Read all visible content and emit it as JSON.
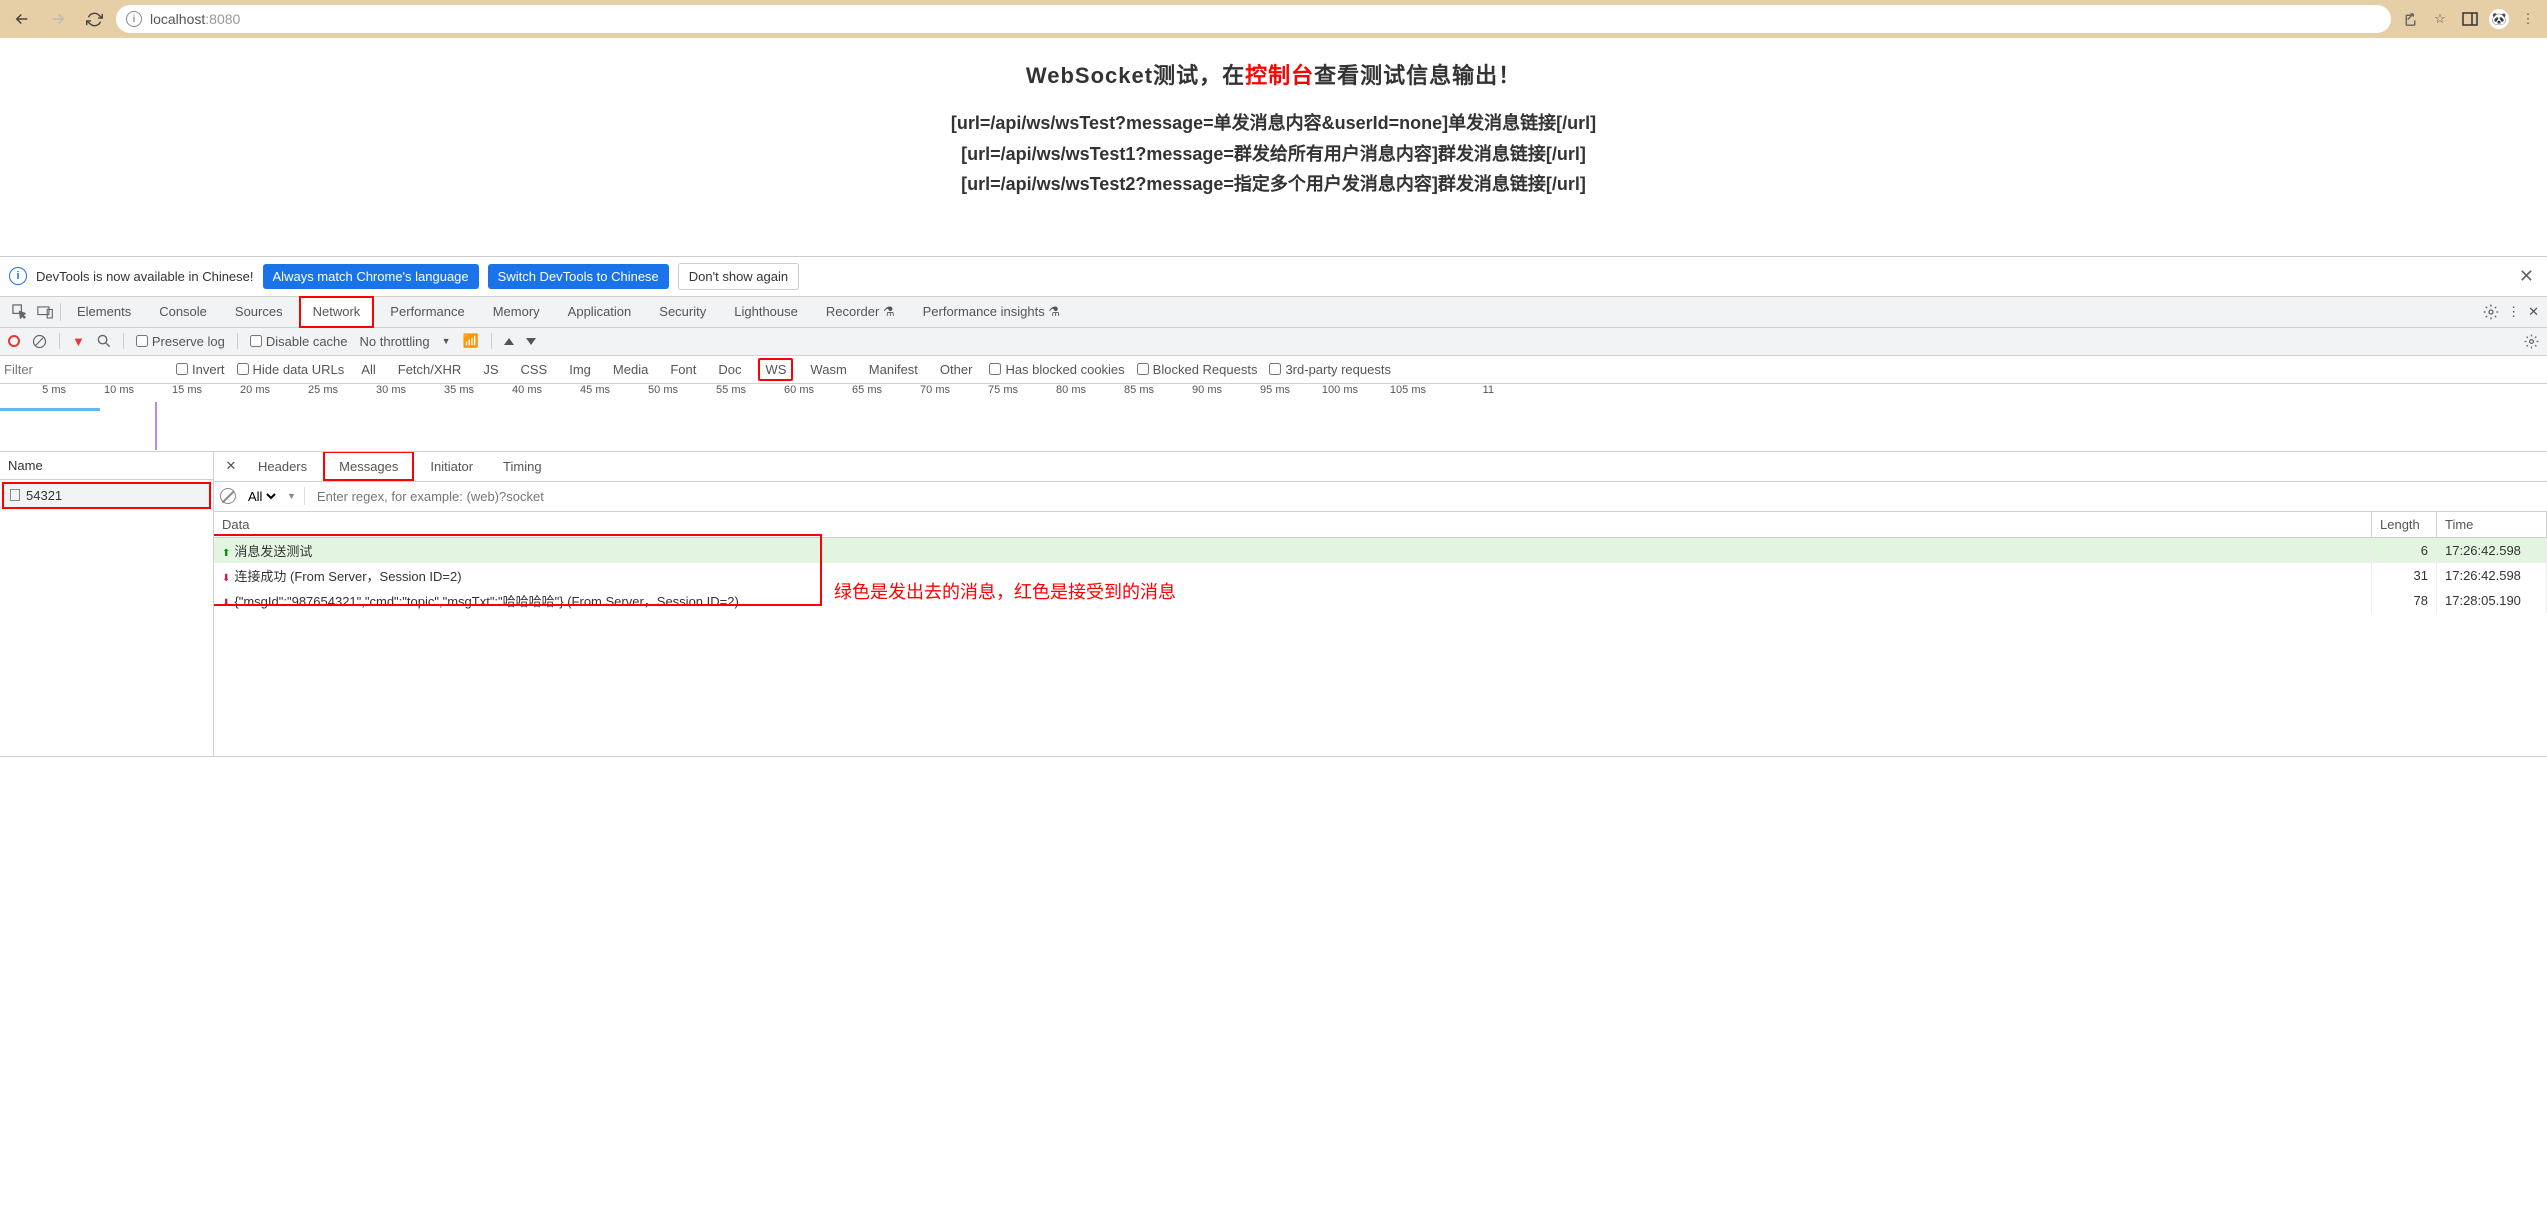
{
  "browser": {
    "url_host": "localhost",
    "url_port": ":8080"
  },
  "page": {
    "title_pre": "WebSocket测试，在",
    "title_red": "控制台",
    "title_post": "查看测试信息输出！",
    "line1": "[url=/api/ws/wsTest?message=单发消息内容&userId=none]单发消息链接[/url]",
    "line2": "[url=/api/ws/wsTest1?message=群发给所有用户消息内容]群发消息链接[/url]",
    "line3": "[url=/api/ws/wsTest2?message=指定多个用户发消息内容]群发消息链接[/url]"
  },
  "lang_bar": {
    "msg": "DevTools is now available in Chinese!",
    "btn1": "Always match Chrome's language",
    "btn2": "Switch DevTools to Chinese",
    "btn3": "Don't show again"
  },
  "devtools_tabs": [
    "Elements",
    "Console",
    "Sources",
    "Network",
    "Performance",
    "Memory",
    "Application",
    "Security",
    "Lighthouse",
    "Recorder ⚗",
    "Performance insights ⚗"
  ],
  "nw1": {
    "preserve": "Preserve log",
    "disable": "Disable cache",
    "throttle": "No throttling"
  },
  "nw2": {
    "filter_ph": "Filter",
    "invert": "Invert",
    "hide": "Hide data URLs",
    "types": [
      "All",
      "Fetch/XHR",
      "JS",
      "CSS",
      "Img",
      "Media",
      "Font",
      "Doc",
      "WS",
      "Wasm",
      "Manifest",
      "Other"
    ],
    "blocked": "Has blocked cookies",
    "blockedr": "Blocked Requests",
    "third": "3rd-party requests"
  },
  "timeline_ticks": [
    "5 ms",
    "10 ms",
    "15 ms",
    "20 ms",
    "25 ms",
    "30 ms",
    "35 ms",
    "40 ms",
    "45 ms",
    "50 ms",
    "55 ms",
    "60 ms",
    "65 ms",
    "70 ms",
    "75 ms",
    "80 ms",
    "85 ms",
    "90 ms",
    "95 ms",
    "100 ms",
    "105 ms",
    "11"
  ],
  "left": {
    "hdr": "Name",
    "item": "54321"
  },
  "sub_tabs": [
    "Headers",
    "Messages",
    "Initiator",
    "Timing"
  ],
  "msg_filter": {
    "all": "All",
    "ph": "Enter regex, for example: (web)?socket"
  },
  "msg_hdr": {
    "data": "Data",
    "len": "Length",
    "time": "Time"
  },
  "msgs": [
    {
      "dir": "up",
      "data": "消息发送测试",
      "len": "6",
      "time": "17:26:42.598"
    },
    {
      "dir": "dn",
      "data": "连接成功 (From Server，Session ID=2)",
      "len": "31",
      "time": "17:26:42.598"
    },
    {
      "dir": "dn",
      "data": "{\"msgId\":\"987654321\",\"cmd\":\"topic\",\"msgTxt\":\"哈哈哈哈\"} (From Server，Session ID=2)",
      "len": "78",
      "time": "17:28:05.190"
    }
  ],
  "annotation": "绿色是发出去的消息，红色是接受到的消息"
}
